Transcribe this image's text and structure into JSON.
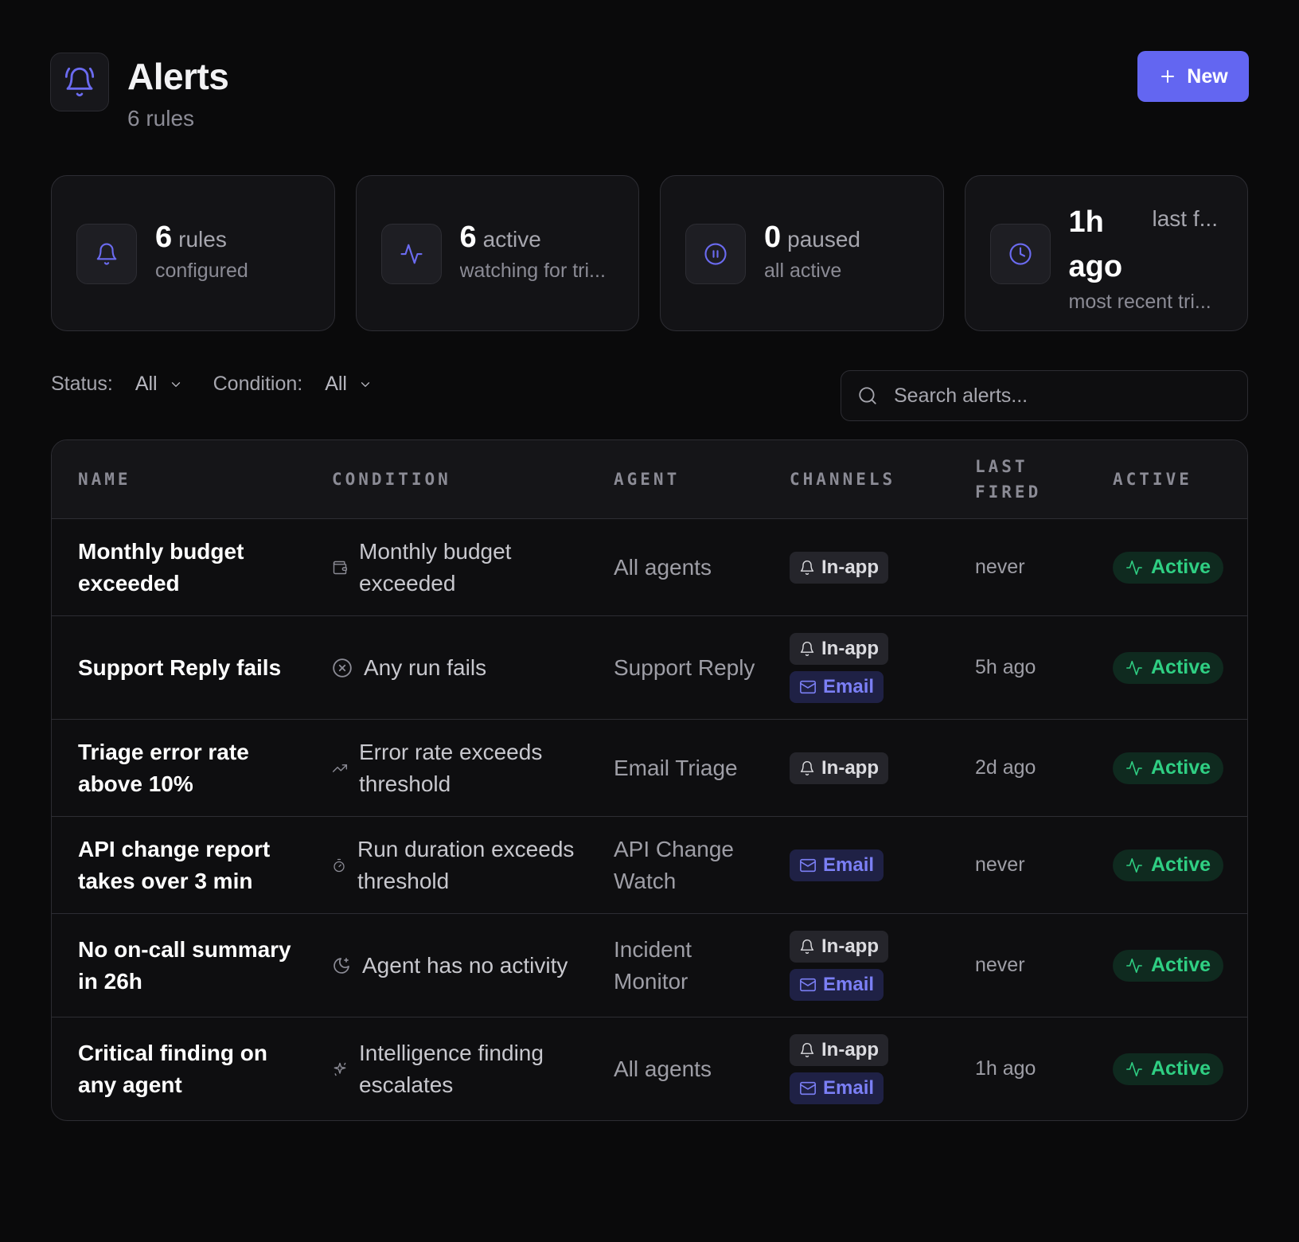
{
  "header": {
    "title": "Alerts",
    "subtitle": "6 rules",
    "new_button_label": "New"
  },
  "stats": [
    {
      "value": "6",
      "label": "rules",
      "description": "configured",
      "icon": "bell-icon"
    },
    {
      "value": "6",
      "label": "active",
      "description": "watching for tri...",
      "icon": "activity-icon"
    },
    {
      "value": "0",
      "label": "paused",
      "description": "all active",
      "icon": "pause-circle-icon"
    },
    {
      "value": "1h ago",
      "label": "last f...",
      "description": "most recent tri...",
      "icon": "clock-icon"
    }
  ],
  "filters": {
    "status_label": "Status:",
    "status_value": "All",
    "condition_label": "Condition:",
    "condition_value": "All"
  },
  "search": {
    "placeholder": "Search alerts..."
  },
  "table": {
    "columns": [
      "NAME",
      "CONDITION",
      "AGENT",
      "CHANNELS",
      "LAST FIRED",
      "ACTIVE"
    ],
    "rows": [
      {
        "name": "Monthly budget exceeded",
        "condition": "Monthly budget exceeded",
        "condition_icon": "wallet-icon",
        "agent": "All agents",
        "channels": [
          "In-app"
        ],
        "last_fired": "never",
        "status": "Active"
      },
      {
        "name": "Support Reply fails",
        "condition": "Any run fails",
        "condition_icon": "x-circle-icon",
        "agent": "Support Reply",
        "channels": [
          "In-app",
          "Email"
        ],
        "last_fired": "5h ago",
        "status": "Active"
      },
      {
        "name": "Triage error rate above 10%",
        "condition": "Error rate exceeds threshold",
        "condition_icon": "trending-up-icon",
        "agent": "Email Triage",
        "channels": [
          "In-app"
        ],
        "last_fired": "2d ago",
        "status": "Active"
      },
      {
        "name": "API change report takes over 3 min",
        "condition": "Run duration exceeds threshold",
        "condition_icon": "timer-icon",
        "agent": "API Change Watch",
        "channels": [
          "Email"
        ],
        "last_fired": "never",
        "status": "Active"
      },
      {
        "name": "No on-call summary in 26h",
        "condition": "Agent has no activity",
        "condition_icon": "moon-icon",
        "agent": "Incident Monitor",
        "channels": [
          "In-app",
          "Email"
        ],
        "last_fired": "never",
        "status": "Active"
      },
      {
        "name": "Critical finding on any agent",
        "condition": "Intelligence finding escalates",
        "condition_icon": "sparkle-icon",
        "agent": "All agents",
        "channels": [
          "In-app",
          "Email"
        ],
        "last_fired": "1h ago",
        "status": "Active"
      }
    ]
  },
  "colors": {
    "background": "#0a0a0b",
    "accent": "#6366f1",
    "active_green": "#2fcf83",
    "email_chip": "#7b7ff5"
  }
}
